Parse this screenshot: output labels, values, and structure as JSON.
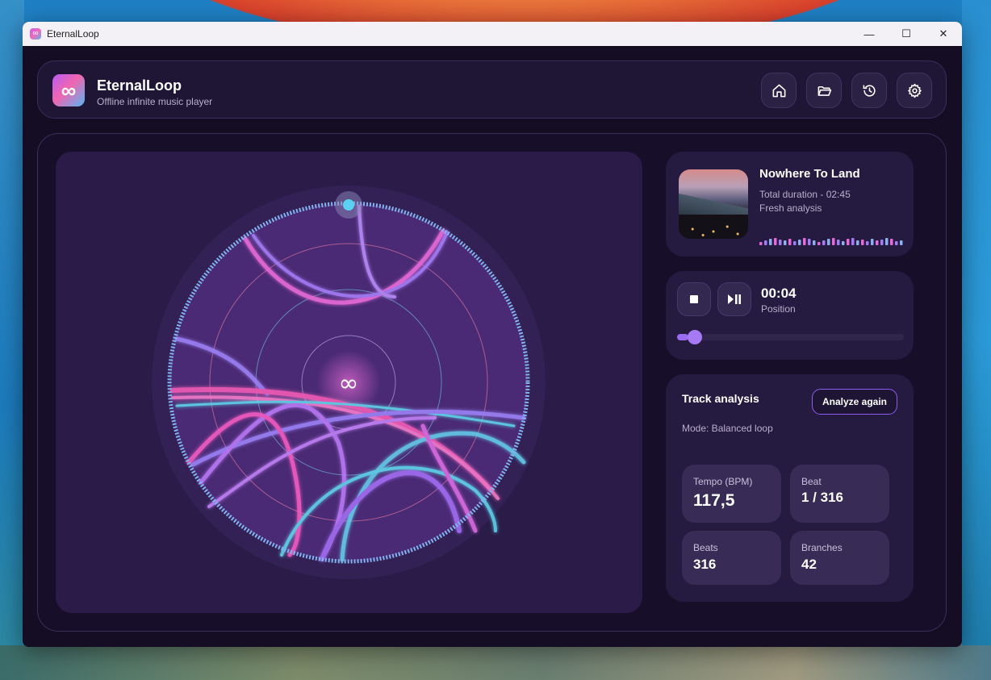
{
  "window": {
    "title": "EternalLoop",
    "controls": [
      "—",
      "☐",
      "✕"
    ]
  },
  "header": {
    "app_name": "EternalLoop",
    "subtitle": "Offline infinite music player",
    "nav": [
      "home-icon",
      "folder-open-icon",
      "history-icon",
      "settings-icon"
    ]
  },
  "visualizer": {
    "center_symbol": "∞",
    "colors": {
      "ring": "#7fb4f0",
      "pink": "#f05ac0",
      "violet": "#a46cf5",
      "cyan": "#5fd0e8"
    }
  },
  "track": {
    "title": "Nowhere To Land",
    "duration": "Total duration - 02:45",
    "status": "Fresh analysis"
  },
  "player": {
    "position_time": "00:04",
    "position_label": "Position",
    "progress": 0.05
  },
  "analysis": {
    "title": "Track analysis",
    "analyze_button": "Analyze again",
    "mode": "Mode: Balanced loop",
    "stats": [
      {
        "label": "Tempo (BPM)",
        "value": "117,5"
      },
      {
        "label": "Beat",
        "value": "1 / 316"
      },
      {
        "label": "Beats",
        "value": "316"
      },
      {
        "label": "Branches",
        "value": "42"
      }
    ]
  },
  "accent": "#9a6cf2"
}
